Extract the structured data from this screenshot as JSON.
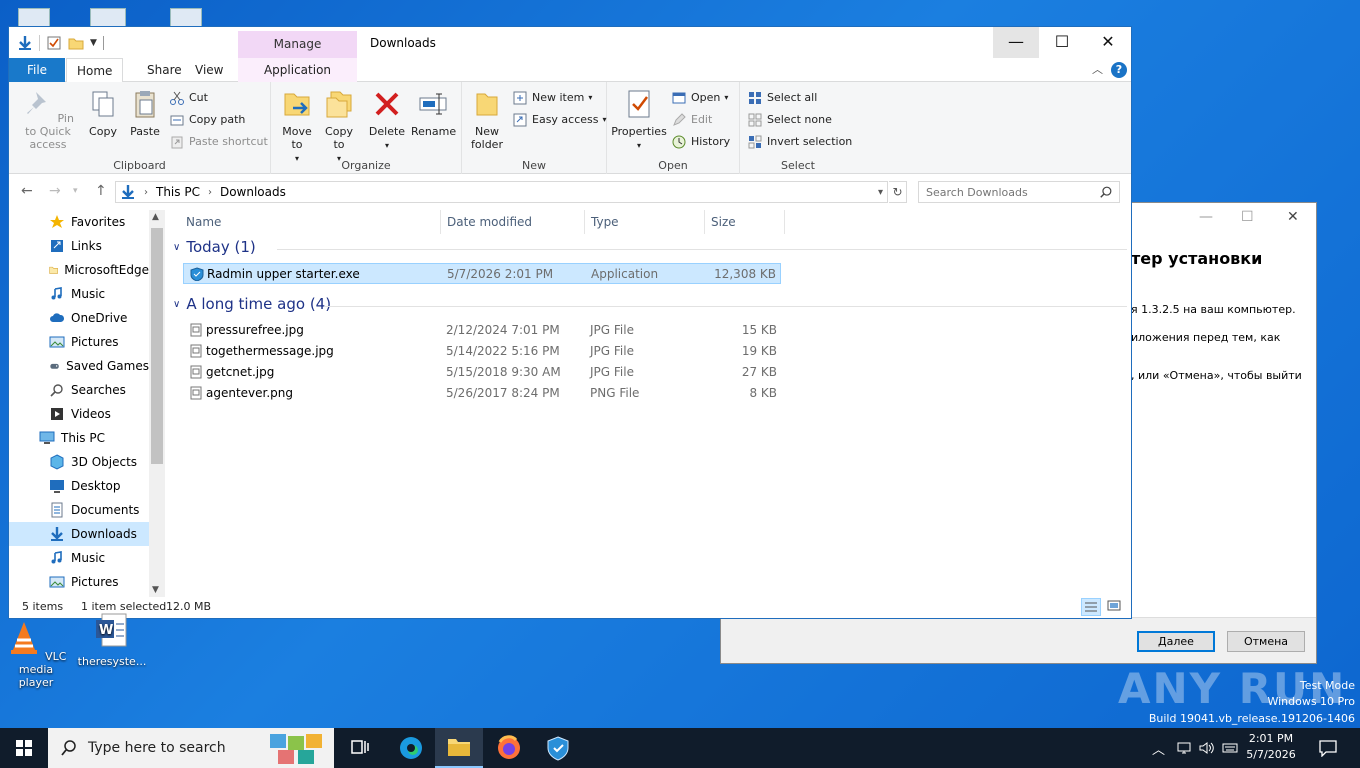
{
  "desktop": {
    "icons": [
      {
        "label": "VLC media player"
      },
      {
        "label": "theresyste..."
      }
    ],
    "watermark": {
      "brand": "ANY RUN",
      "line1": "Test Mode",
      "line2": "Windows 10 Pro",
      "line3": "Build 19041.vb_release.191206-1406"
    }
  },
  "installer": {
    "title_partial": "тер установки",
    "lines": [
      "я 1.3.2.5 на ваш компьютер.",
      "иложения перед тем, как",
      ", или «Отмена», чтобы выйти"
    ],
    "next_button": "Далее",
    "cancel_button": "Отмена"
  },
  "explorer": {
    "window_title": "Downloads",
    "context_tab_header": "Manage",
    "tabs": {
      "file": "File",
      "home": "Home",
      "share": "Share",
      "view": "View",
      "app_tools": "Application Tools"
    },
    "ribbon": {
      "clipboard": {
        "label": "Clipboard",
        "pin": "Pin to Quick access",
        "copy": "Copy",
        "paste": "Paste",
        "cut": "Cut",
        "copy_path": "Copy path",
        "paste_shortcut": "Paste shortcut"
      },
      "organize": {
        "label": "Organize",
        "move_to": "Move to",
        "copy_to": "Copy to",
        "delete": "Delete",
        "rename": "Rename"
      },
      "new": {
        "label": "New",
        "new_folder": "New folder",
        "new_item": "New item",
        "easy_access": "Easy access"
      },
      "open": {
        "label": "Open",
        "properties": "Properties",
        "open": "Open",
        "edit": "Edit",
        "history": "History"
      },
      "select": {
        "label": "Select",
        "select_all": "Select all",
        "select_none": "Select none",
        "invert": "Invert selection"
      }
    },
    "address": {
      "crumbs": [
        "This PC",
        "Downloads"
      ],
      "search_placeholder": "Search Downloads"
    },
    "nav": [
      {
        "label": "Favorites",
        "icon": "star-icon"
      },
      {
        "label": "Links",
        "icon": "link-icon"
      },
      {
        "label": "MicrosoftEdge",
        "icon": "folder-icon"
      },
      {
        "label": "Music",
        "icon": "music-icon"
      },
      {
        "label": "OneDrive",
        "icon": "cloud-icon"
      },
      {
        "label": "Pictures",
        "icon": "pictures-icon"
      },
      {
        "label": "Saved Games",
        "icon": "games-icon"
      },
      {
        "label": "Searches",
        "icon": "search-icon"
      },
      {
        "label": "Videos",
        "icon": "videos-icon"
      },
      {
        "label": "This PC",
        "icon": "computer-icon"
      },
      {
        "label": "3D Objects",
        "icon": "cube-icon"
      },
      {
        "label": "Desktop",
        "icon": "desktop-icon"
      },
      {
        "label": "Documents",
        "icon": "documents-icon"
      },
      {
        "label": "Downloads",
        "icon": "downloads-icon"
      },
      {
        "label": "Music",
        "icon": "music-icon"
      },
      {
        "label": "Pictures",
        "icon": "pictures-icon"
      }
    ],
    "columns": [
      "Name",
      "Date modified",
      "Type",
      "Size"
    ],
    "groups": [
      {
        "title": "Today (1)",
        "files": [
          {
            "name": "Radmin upper starter.exe",
            "date": "5/7/2026 2:01 PM",
            "type": "Application",
            "size": "12,308 KB",
            "selected": true
          }
        ]
      },
      {
        "title": "A long time ago (4)",
        "files": [
          {
            "name": "pressurefree.jpg",
            "date": "2/12/2024 7:01 PM",
            "type": "JPG File",
            "size": "15 KB"
          },
          {
            "name": "togethermessage.jpg",
            "date": "5/14/2022 5:16 PM",
            "type": "JPG File",
            "size": "19 KB"
          },
          {
            "name": "getcnet.jpg",
            "date": "5/15/2018 9:30 AM",
            "type": "JPG File",
            "size": "27 KB"
          },
          {
            "name": "agentever.png",
            "date": "5/26/2017 8:24 PM",
            "type": "PNG File",
            "size": "8 KB"
          }
        ]
      }
    ],
    "status": {
      "count": "5 items",
      "selection": "1 item selected",
      "selection_size": "12.0 MB"
    }
  },
  "taskbar": {
    "search_placeholder": "Type here to search",
    "time": "2:01 PM",
    "date": "5/7/2026"
  },
  "colors": {
    "desktop_bg": "#0b5fc7",
    "file_tab": "#1979ca",
    "manage_tab": "#f2d8f6",
    "selection": "#cce8ff",
    "group_title": "#1e3287",
    "taskbar": "#101c2b"
  }
}
